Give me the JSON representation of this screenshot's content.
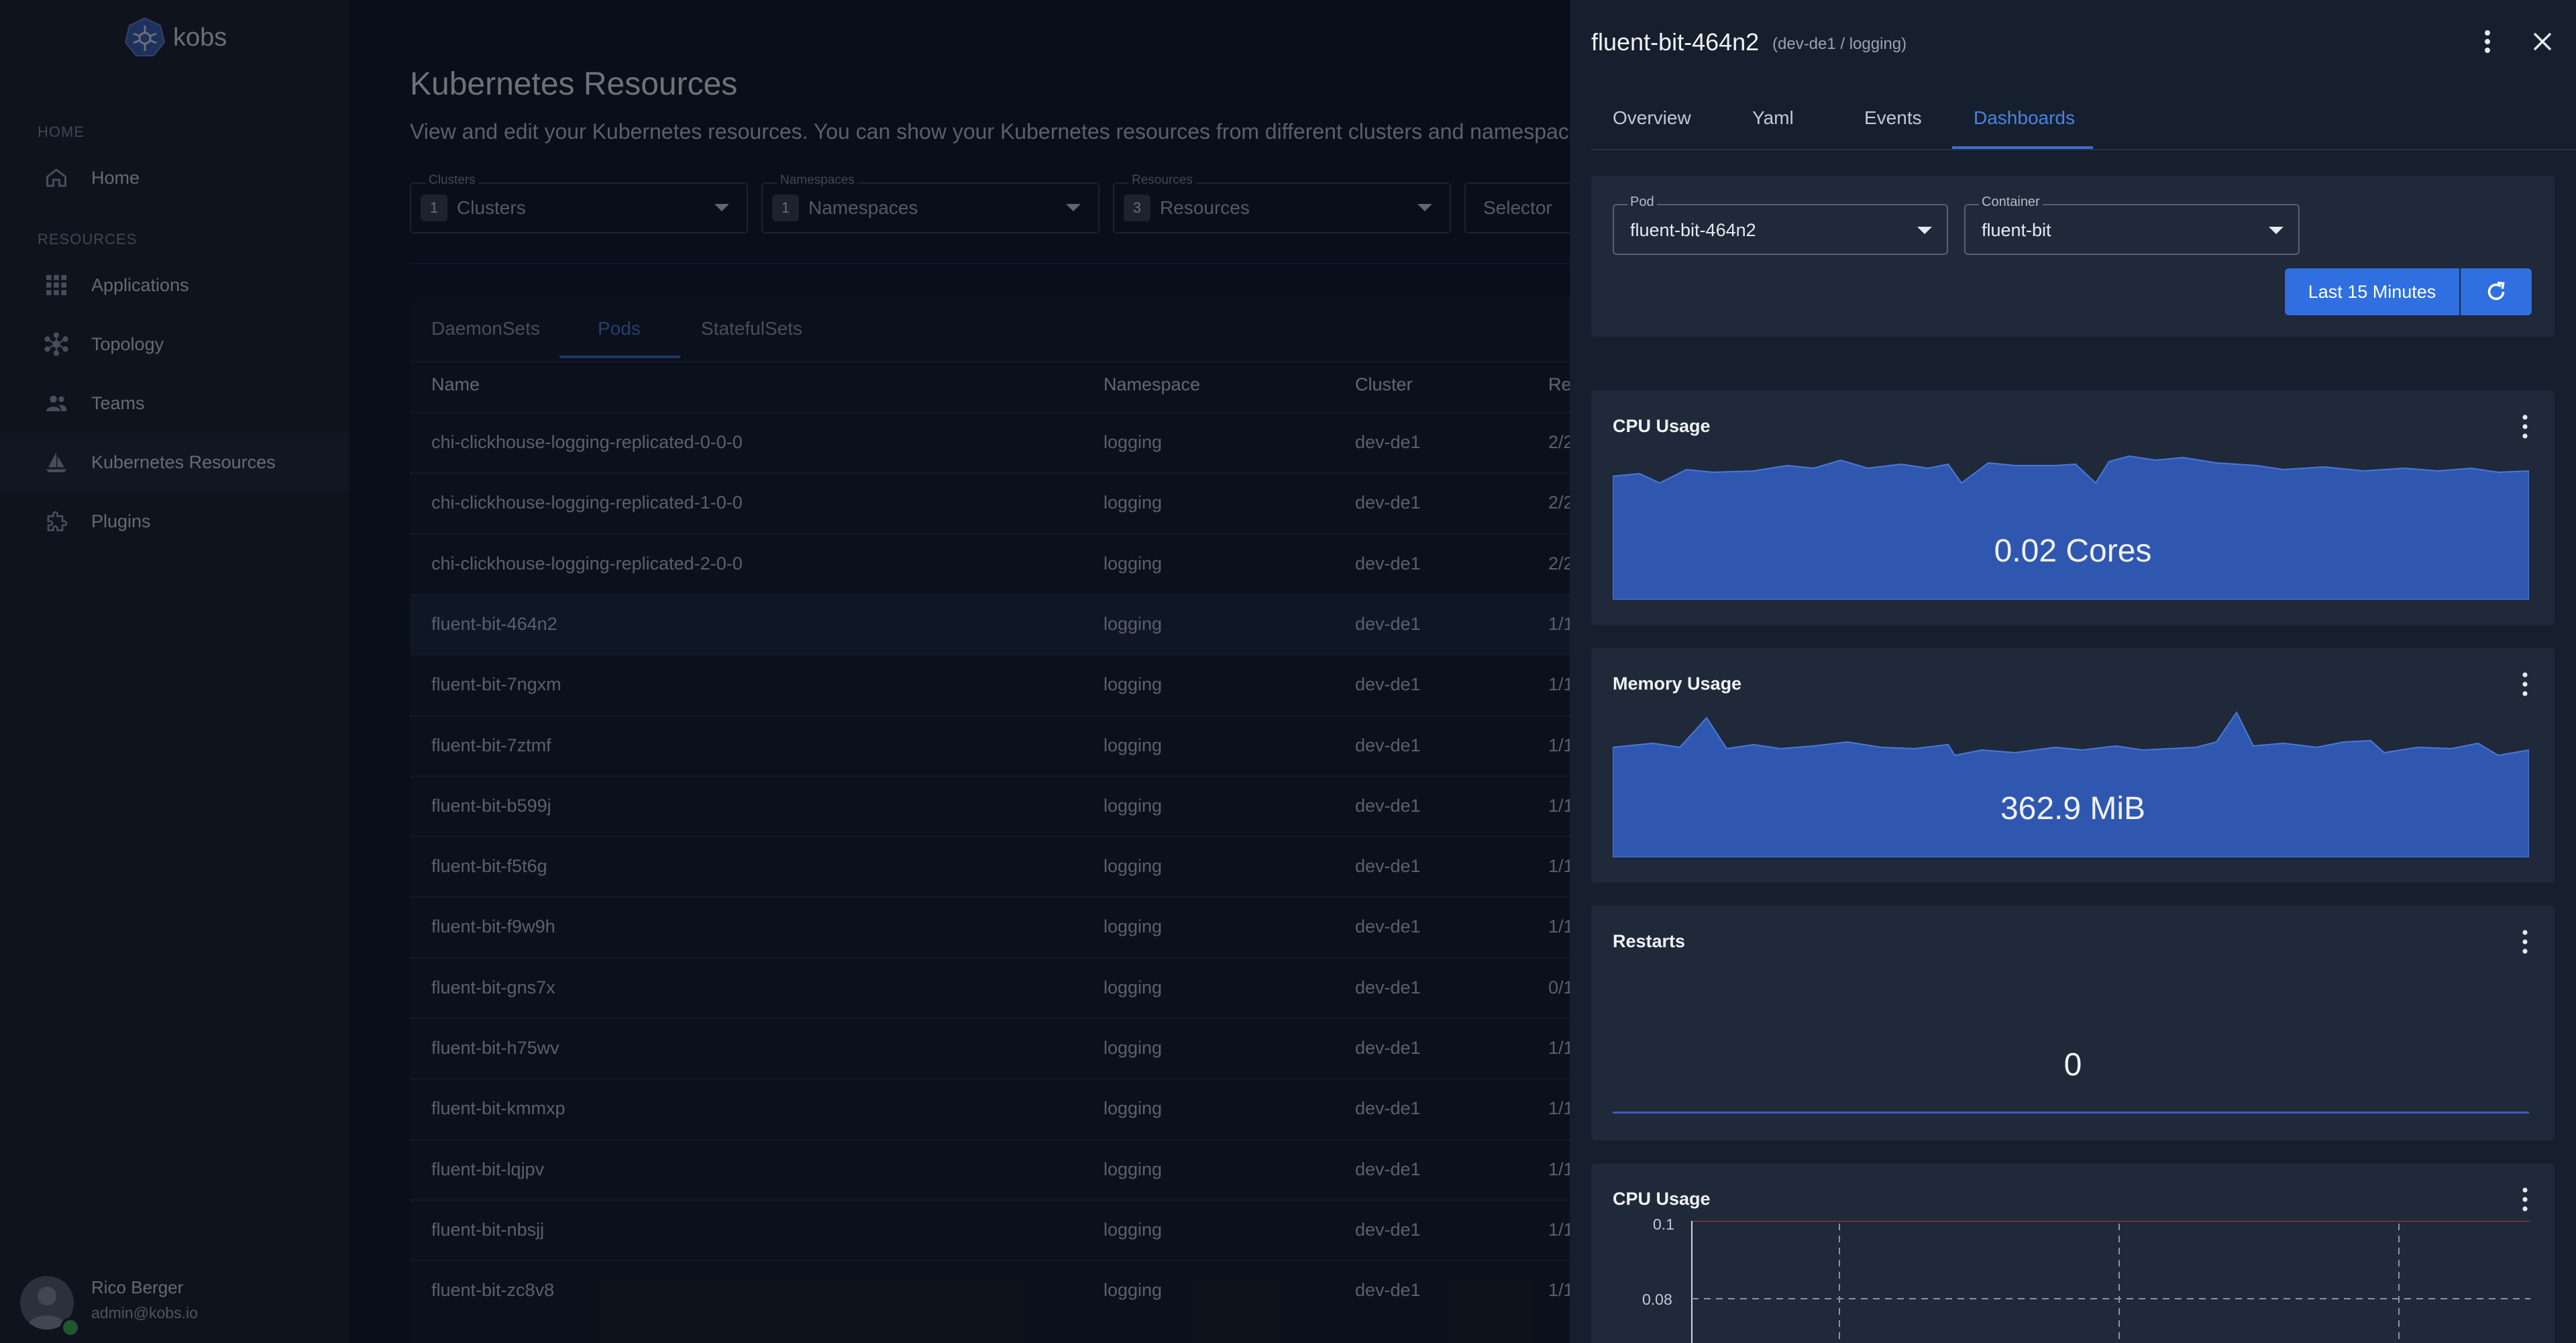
{
  "app": {
    "name": "kobs"
  },
  "sidebar": {
    "sections": [
      {
        "label": "HOME",
        "items": [
          {
            "label": "Home",
            "icon": "home-icon"
          }
        ]
      },
      {
        "label": "RESOURCES",
        "items": [
          {
            "label": "Applications",
            "icon": "grid-icon"
          },
          {
            "label": "Topology",
            "icon": "topology-icon"
          },
          {
            "label": "Teams",
            "icon": "team-icon"
          },
          {
            "label": "Kubernetes Resources",
            "icon": "kubernetes-icon",
            "active": true
          },
          {
            "label": "Plugins",
            "icon": "puzzle-icon"
          }
        ]
      }
    ],
    "user": {
      "name": "Rico Berger",
      "email": "admin@kobs.io"
    }
  },
  "main": {
    "title": "Kubernetes Resources",
    "description": "View and edit your Kubernetes resources. You can show your Kubernetes resources from different clusters and namespaces. Yo",
    "filters": [
      {
        "label": "Clusters",
        "count": "1",
        "value": "Clusters"
      },
      {
        "label": "Namespaces",
        "count": "1",
        "value": "Namespaces"
      },
      {
        "label": "Resources",
        "count": "3",
        "value": "Resources"
      },
      {
        "placeholder": "Selector"
      }
    ],
    "tabs": [
      "DaemonSets",
      "Pods",
      "StatefulSets"
    ],
    "active_tab": "Pods",
    "columns": [
      "Name",
      "Namespace",
      "Cluster",
      "Re"
    ],
    "rows": [
      {
        "name": "chi-clickhouse-logging-replicated-0-0-0",
        "namespace": "logging",
        "cluster": "dev-de1",
        "ready": "2/2"
      },
      {
        "name": "chi-clickhouse-logging-replicated-1-0-0",
        "namespace": "logging",
        "cluster": "dev-de1",
        "ready": "2/2"
      },
      {
        "name": "chi-clickhouse-logging-replicated-2-0-0",
        "namespace": "logging",
        "cluster": "dev-de1",
        "ready": "2/2"
      },
      {
        "name": "fluent-bit-464n2",
        "namespace": "logging",
        "cluster": "dev-de1",
        "ready": "1/1",
        "selected": true
      },
      {
        "name": "fluent-bit-7ngxm",
        "namespace": "logging",
        "cluster": "dev-de1",
        "ready": "1/1"
      },
      {
        "name": "fluent-bit-7ztmf",
        "namespace": "logging",
        "cluster": "dev-de1",
        "ready": "1/1"
      },
      {
        "name": "fluent-bit-b599j",
        "namespace": "logging",
        "cluster": "dev-de1",
        "ready": "1/1"
      },
      {
        "name": "fluent-bit-f5t6g",
        "namespace": "logging",
        "cluster": "dev-de1",
        "ready": "1/1"
      },
      {
        "name": "fluent-bit-f9w9h",
        "namespace": "logging",
        "cluster": "dev-de1",
        "ready": "1/1"
      },
      {
        "name": "fluent-bit-gns7x",
        "namespace": "logging",
        "cluster": "dev-de1",
        "ready": "0/1"
      },
      {
        "name": "fluent-bit-h75wv",
        "namespace": "logging",
        "cluster": "dev-de1",
        "ready": "1/1"
      },
      {
        "name": "fluent-bit-kmmxp",
        "namespace": "logging",
        "cluster": "dev-de1",
        "ready": "1/1"
      },
      {
        "name": "fluent-bit-lqjpv",
        "namespace": "logging",
        "cluster": "dev-de1",
        "ready": "1/1"
      },
      {
        "name": "fluent-bit-nbsjj",
        "namespace": "logging",
        "cluster": "dev-de1",
        "ready": "1/1"
      },
      {
        "name": "fluent-bit-zc8v8",
        "namespace": "logging",
        "cluster": "dev-de1",
        "ready": "1/1"
      }
    ]
  },
  "drawer": {
    "title": "fluent-bit-464n2",
    "subtitle": "(dev-de1 / logging)",
    "tabs": [
      "Overview",
      "Yaml",
      "Events",
      "Dashboards"
    ],
    "active_tab": "Dashboards",
    "pod_select": {
      "label": "Pod",
      "value": "fluent-bit-464n2"
    },
    "container_select": {
      "label": "Container",
      "value": "fluent-bit"
    },
    "time_button": "Last 15 Minutes",
    "cards": [
      {
        "title": "CPU Usage",
        "value": "0.02 Cores"
      },
      {
        "title": "Memory Usage",
        "value": "362.9 MiB"
      },
      {
        "title": "Restarts",
        "value": "0"
      },
      {
        "title": "CPU Usage",
        "y_ticks": [
          "0.1",
          "0.08"
        ]
      }
    ]
  },
  "colors": {
    "accent": "#2f6fe0",
    "sparkline": "#3057b0",
    "sidebar": "#1b2230",
    "drawer": "#151f2e",
    "panel": "#1f293a"
  }
}
